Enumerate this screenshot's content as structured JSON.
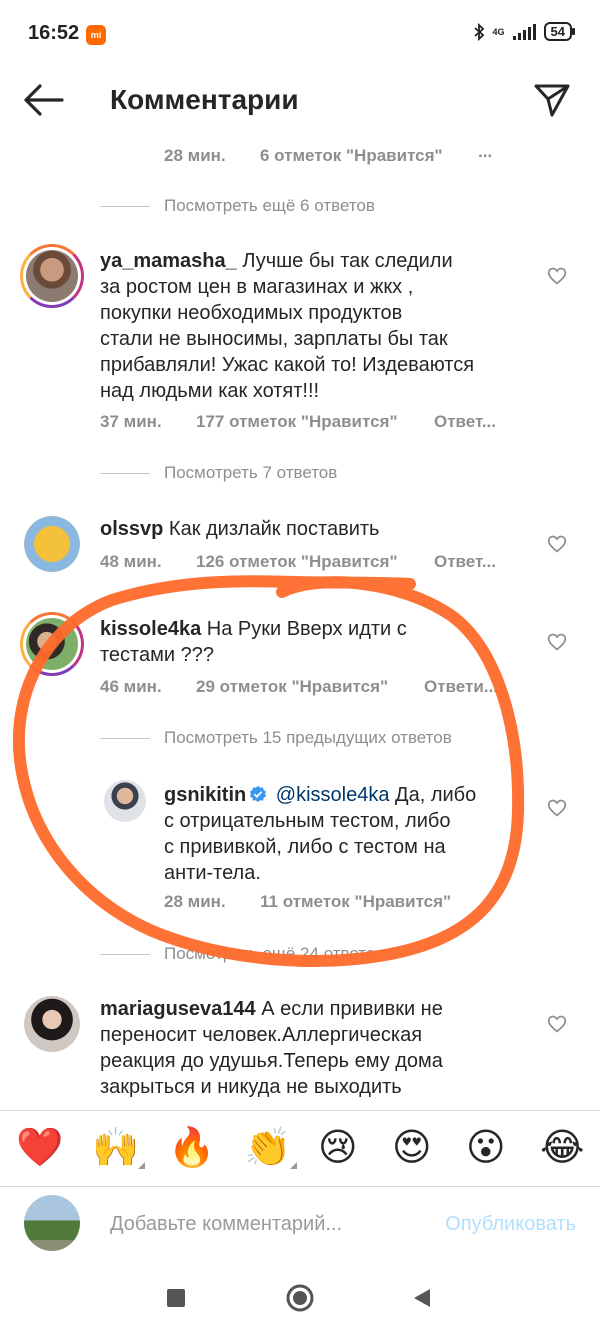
{
  "status_bar": {
    "time": "16:52",
    "network": "4G",
    "battery": "54"
  },
  "header": {
    "title": "Комментарии"
  },
  "thread": [
    {
      "meta": {
        "time": "28 мин.",
        "likes": "6 отметок \"Нравится\"",
        "more": "..."
      }
    },
    {
      "view_more": "Посмотреть ещё 6 ответов"
    },
    {
      "comment": {
        "username": "ya_mamasha_",
        "lines": [
          "Лучше бы так следили",
          "за ростом цен в магазинах и жкх ,",
          "покупки необходимых продуктов",
          "стали не выносимы, зарплаты бы так",
          "прибавляли! Ужас какой то! Издеваются",
          "над людьми как хотят!!!"
        ],
        "time": "37 мин.",
        "likes": "177 отметок \"Нравится\"",
        "reply": "Ответ..."
      }
    },
    {
      "view_more": "Посмотреть 7 ответов"
    },
    {
      "comment": {
        "username": "olssvp",
        "text": "Как дизлайк поставить",
        "time": "48 мин.",
        "likes": "126 отметок \"Нравится\"",
        "reply": "Ответ..."
      }
    },
    {
      "comment": {
        "username": "kissole4ka",
        "lines": [
          "На Руки Вверх идти с",
          "тестами ???"
        ],
        "time": "46 мин.",
        "likes": "29 отметок \"Нравится\"",
        "reply": "Ответи..."
      }
    },
    {
      "view_more": "Посмотреть 15 предыдущих ответов"
    },
    {
      "reply": {
        "username": "gsnikitin",
        "mention": "@kissole4ka",
        "lines": [
          "Да, либо",
          "с отрицательным тестом, либо",
          "с прививкой, либо с тестом на",
          "анти-тела."
        ],
        "time": "28 мин.",
        "likes": "11 отметок \"Нравится\""
      }
    },
    {
      "view_more": "Посмотреть ещё 24 ответа"
    },
    {
      "comment": {
        "username": "mariaguseva144",
        "lines": [
          "А если прививки не",
          "переносит человек.Аллергическая",
          "реакция до удушья.Теперь ему дома",
          "закрыться и никуда не выходить"
        ]
      }
    }
  ],
  "emoji_bar": [
    "red-heart",
    "raising-hands",
    "fire",
    "clapping-hands",
    "crying-face",
    "heart-eyes",
    "surprised-face",
    "tears-of-joy"
  ],
  "composer": {
    "placeholder": "Добавьте комментарий...",
    "publish": "Опубликовать"
  },
  "colors": {
    "annotation": "#ff6a2b",
    "verified": "#3897f0",
    "publish": "#b2dffc",
    "muted": "#8e8e8e"
  }
}
